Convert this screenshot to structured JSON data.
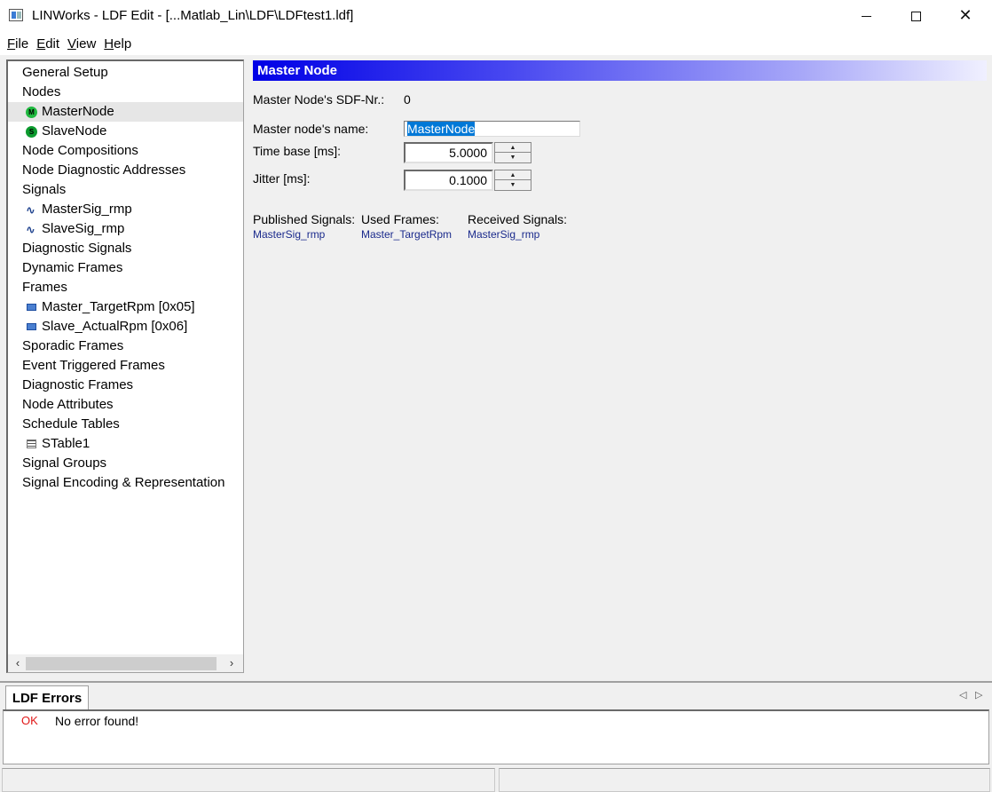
{
  "window": {
    "title": "LINWorks - LDF Edit - [...Matlab_Lin\\LDF\\LDFtest1.ldf]",
    "minimize": "—",
    "close": "✕"
  },
  "menu": {
    "file": "F",
    "file_rest": "ile",
    "edit": "E",
    "edit_rest": "dit",
    "view": "V",
    "view_rest": "iew",
    "help": "H",
    "help_rest": "elp"
  },
  "tree": {
    "items": [
      {
        "label": "General Setup"
      },
      {
        "label": "Nodes"
      },
      {
        "label": "MasterNode",
        "icon": "master-node-icon",
        "glyph": "M"
      },
      {
        "label": "SlaveNode",
        "icon": "slave-node-icon",
        "glyph": "S"
      },
      {
        "label": "Node Compositions"
      },
      {
        "label": "Node Diagnostic Addresses"
      },
      {
        "label": "Signals"
      },
      {
        "label": "MasterSig_rmp",
        "icon": "signal-icon",
        "glyph": "∿"
      },
      {
        "label": "SlaveSig_rmp",
        "icon": "signal-icon",
        "glyph": "∿"
      },
      {
        "label": "Diagnostic Signals"
      },
      {
        "label": "Dynamic Frames"
      },
      {
        "label": "Frames"
      },
      {
        "label": "Master_TargetRpm [0x05]",
        "icon": "frame-icon"
      },
      {
        "label": "Slave_ActualRpm [0x06]",
        "icon": "frame-icon"
      },
      {
        "label": "Sporadic Frames"
      },
      {
        "label": "Event Triggered Frames"
      },
      {
        "label": "Diagnostic Frames"
      },
      {
        "label": "Node Attributes"
      },
      {
        "label": "Schedule Tables"
      },
      {
        "label": "STable1",
        "icon": "table-icon"
      },
      {
        "label": "Signal Groups"
      },
      {
        "label": "Signal Encoding & Representation"
      }
    ],
    "scroll_left": "‹",
    "scroll_right": "›"
  },
  "panel": {
    "header": "Master Node",
    "sdf_label": "Master Node's SDF-Nr.:",
    "sdf_value": "0",
    "name_label": "Master node's name:",
    "name_value": "MasterNode",
    "time_base_label": "Time base [ms]:",
    "time_base_value": "5.0000",
    "jitter_label": "Jitter [ms]:",
    "jitter_value": "0.1000",
    "spin_up": "▲",
    "spin_down": "▼",
    "published_label": "Published Signals:",
    "published_value": "MasterSig_rmp",
    "used_frames_label": "Used Frames:",
    "used_frames_value": "Master_TargetRpm",
    "received_label": "Received Signals:",
    "received_value": "MasterSig_rmp"
  },
  "bottom": {
    "tab_label": "LDF Errors",
    "nav_left": "◁",
    "nav_right": "▷",
    "status_ok": "OK",
    "status_message": "No error found!"
  },
  "colors": {
    "header_start": "#0000e6",
    "selection": "#0078d7",
    "ok_red": "#e01818",
    "link_blue": "#1a2a8c"
  }
}
